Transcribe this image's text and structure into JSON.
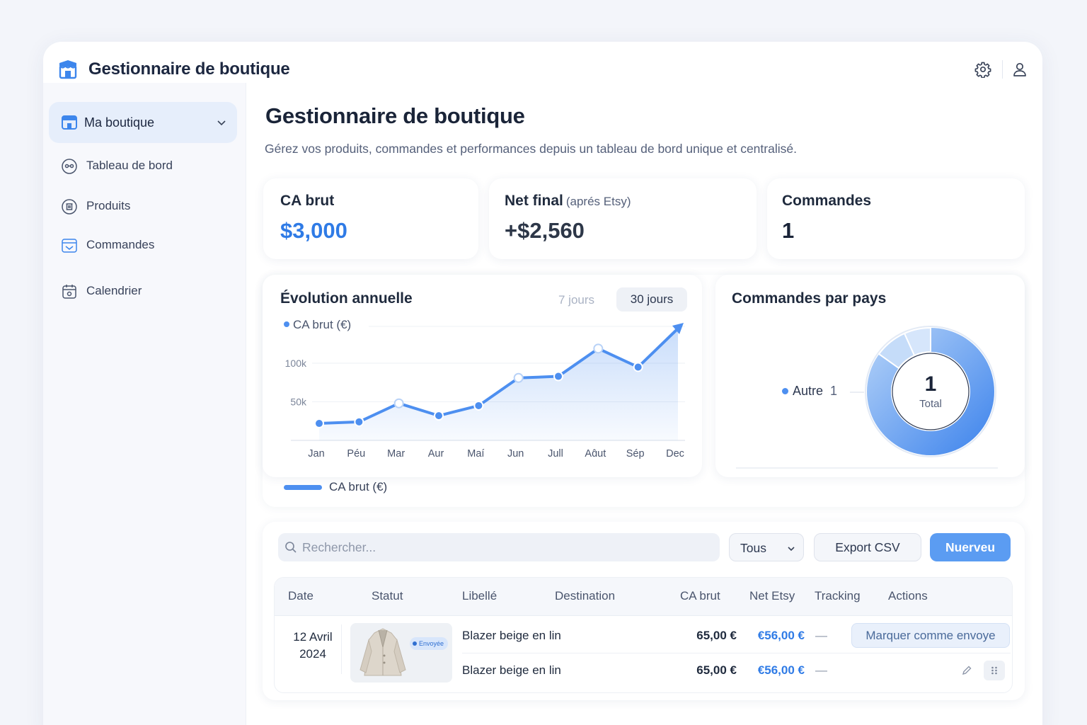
{
  "app": {
    "title": "Gestionnaire de boutique"
  },
  "sidebar": {
    "shop": "Ma boutique",
    "items": [
      {
        "label": "Tableau de bord",
        "icon": "dashboard-icon"
      },
      {
        "label": "Produits",
        "icon": "products-icon"
      },
      {
        "label": "Commandes",
        "icon": "orders-icon"
      },
      {
        "label": "Calendrier",
        "icon": "calendar-icon"
      }
    ]
  },
  "page": {
    "title": "Gestionnaire de boutique",
    "subtitle": "Gérez vos produits, commandes et performances depuis un tableau de bord unique et centralisé."
  },
  "stats": {
    "gross": {
      "label": "CA brut",
      "value": "$3,000"
    },
    "net": {
      "label": "Net final",
      "note": "(aprés Etsy)",
      "value": "+$2,560"
    },
    "orders": {
      "label": "Commandes",
      "value": "1"
    }
  },
  "colors": {
    "accent": "#2f7be6",
    "primary_button": "#5b9cf2",
    "series": "#4d8ff0"
  },
  "chart_data": [
    {
      "type": "area",
      "title": "Évolution annuelle",
      "range_options": [
        "7 jours",
        "30 jours"
      ],
      "range_selected": "30 jours",
      "legend_label": "CA brut (€)",
      "series": [
        {
          "name": "CA brut (€)",
          "values": [
            22000,
            24000,
            48000,
            32000,
            45000,
            81000,
            83000,
            119000,
            95000,
            145000
          ]
        }
      ],
      "categories": [
        "Jan",
        "Péu",
        "Mar",
        "Aur",
        "Maí",
        "Jun",
        "Jull",
        "Aɑ̂ut",
        "Sép",
        "Dec"
      ],
      "yticks": [
        {
          "value": 50000,
          "label": "50k"
        },
        {
          "value": 100000,
          "label": "100k"
        }
      ],
      "ylim": [
        0,
        145000
      ],
      "grid": true
    },
    {
      "type": "pie",
      "title": "Commandes par pays",
      "slices": [
        {
          "label": "Autre",
          "value": 1,
          "color": "#4d8ff0"
        }
      ],
      "total": {
        "value": "1",
        "label": "Total"
      },
      "legend_position": "left"
    }
  ],
  "toolbar": {
    "search_placeholder": "Rechercher...",
    "filter_value": "Tous",
    "export_label": "Export CSV",
    "new_label": "Nuerveu"
  },
  "table": {
    "headers": [
      "Date",
      "Statut",
      "Libellé",
      "Destination",
      "CA brut",
      "Net Etsy",
      "Tracking",
      "Actions"
    ],
    "order": {
      "date_line1": "12 Avril",
      "date_line2": "2024",
      "status_badge": "Envoyée",
      "mark_label": "Marquer comme envoye",
      "rows": [
        {
          "label": "Blazer beige en lin",
          "gross": "65,00 €",
          "net": "€56,00 €",
          "tracking": "—"
        },
        {
          "label": "Blazer beige en lin",
          "gross": "65,00 €",
          "net": "€56,00 €",
          "tracking": "—"
        }
      ]
    }
  }
}
